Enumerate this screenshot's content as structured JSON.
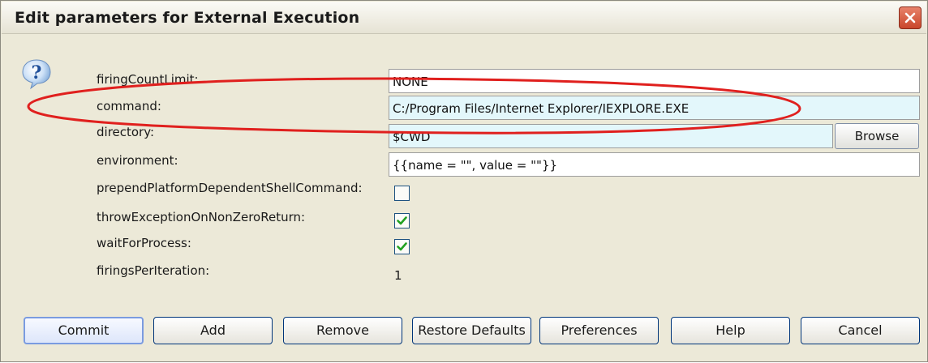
{
  "window": {
    "title": "Edit parameters for External Execution"
  },
  "params": [
    {
      "label": "firingCountLimit:",
      "value": "NONE"
    },
    {
      "label": "command:",
      "value": "C:/Program Files/Internet Explorer/IEXPLORE.EXE"
    },
    {
      "label": "directory:",
      "value": "$CWD"
    },
    {
      "label": "environment:",
      "value": "{{name = \"\", value = \"\"}}"
    },
    {
      "label": "prependPlatformDependentShellCommand:",
      "checked": false
    },
    {
      "label": "throwExceptionOnNonZeroReturn:",
      "checked": true
    },
    {
      "label": "waitForProcess:",
      "checked": true
    },
    {
      "label": "firingsPerIteration:",
      "value": "1"
    }
  ],
  "browse_label": "Browse",
  "buttons": {
    "commit": "Commit",
    "add": "Add",
    "remove": "Remove",
    "restore_defaults": "Restore Defaults",
    "preferences": "Preferences",
    "help": "Help",
    "cancel": "Cancel"
  },
  "colors": {
    "dialog_bg": "#ece9d8",
    "highlight_oval": "#e0201e",
    "field_cyan": "#e3f7fb",
    "check_green": "#21a121"
  }
}
